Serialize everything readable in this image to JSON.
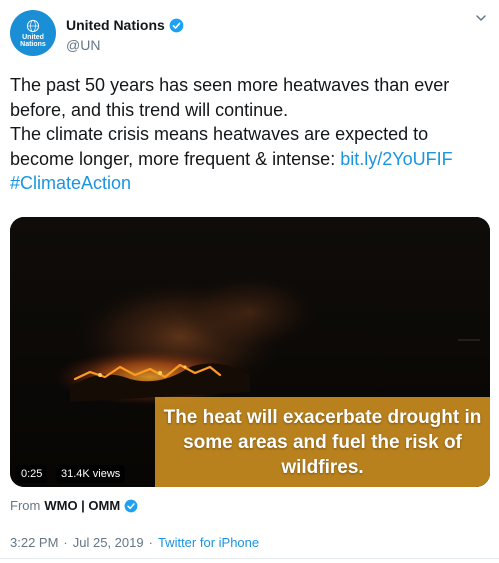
{
  "account": {
    "display_name": "United Nations",
    "handle": "@UN",
    "avatar_text_line1": "United",
    "avatar_text_line2": "Nations",
    "verified": true
  },
  "tweet": {
    "lines": [
      "The past 50 years has seen more heatwaves than ever",
      "before, and this trend will continue.",
      "The climate crisis means heatwaves are expected to",
      "become longer, more frequent & intense: "
    ],
    "link": "bit.ly/2YoUFIF",
    "hashtag": "#ClimateAction"
  },
  "media": {
    "caption_line1": "The heat will exacerbate drought in",
    "caption_line2": "some areas and fuel the risk of",
    "caption_line3": "wildfires.",
    "duration": "0:25",
    "views": "31.4K views"
  },
  "source": {
    "label": "From",
    "name": "WMO | OMM",
    "verified": true
  },
  "meta": {
    "time": "3:22 PM",
    "date": "Jul 25, 2019",
    "separator": "·",
    "client": "Twitter for iPhone"
  },
  "colors": {
    "link": "#1b95e0",
    "verified_badge": "#1da1f2",
    "avatar_bg": "#1b8fd6",
    "caption_bg": "#c98c20",
    "secondary_text": "#657786"
  },
  "icons": {
    "verified": "verified-badge-icon",
    "caret": "chevron-down-icon",
    "logo": "un-emblem-icon"
  }
}
